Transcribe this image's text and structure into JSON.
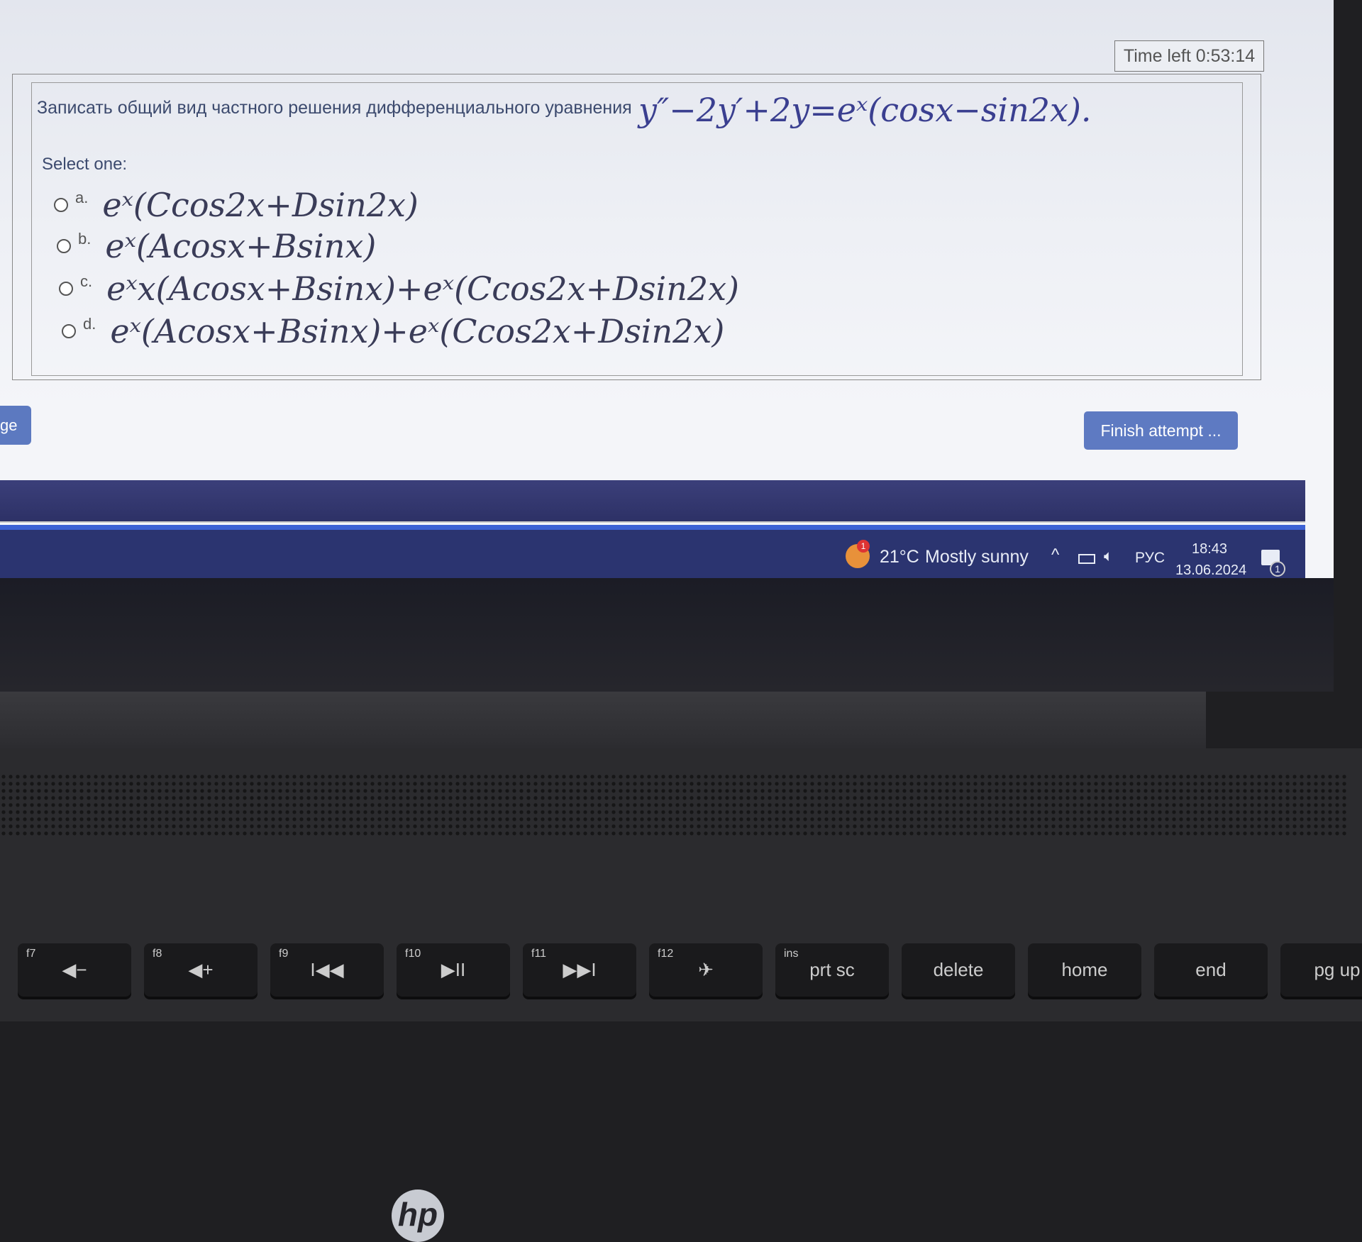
{
  "timer": {
    "label": "Time left 0:53:14"
  },
  "question": {
    "text": "Записать общий вид частного решения дифференциального уравнения",
    "equation": "y″−2y′+2y=eˣ(cosx−sin2x)."
  },
  "select_one": "Select one:",
  "options": [
    {
      "letter": "a.",
      "math": "eˣ(Ccos2x+Dsin2x)"
    },
    {
      "letter": "b.",
      "math": "eˣ(Acosx+Bsinx)"
    },
    {
      "letter": "c.",
      "math": "eˣx(Acosx+Bsinx)+eˣ(Ccos2x+Dsin2x)"
    },
    {
      "letter": "d.",
      "math": "eˣ(Acosx+Bsinx)+eˣ(Ccos2x+Dsin2x)"
    }
  ],
  "nav": {
    "prev_label": "ge",
    "finish_label": "Finish attempt ..."
  },
  "taskbar": {
    "weather_badge": "1",
    "temperature": "21°C",
    "weather": "Mostly sunny",
    "language": "РУС",
    "time": "18:43",
    "date": "13.06.2024",
    "notifications": "1"
  },
  "logo": "hp",
  "keys": [
    {
      "fn": "f7",
      "main": "◀−"
    },
    {
      "fn": "f8",
      "main": "◀+"
    },
    {
      "fn": "f9",
      "main": "I◀◀"
    },
    {
      "fn": "f10",
      "main": "▶II"
    },
    {
      "fn": "f11",
      "main": "▶▶I"
    },
    {
      "fn": "f12",
      "main": "✈"
    },
    {
      "fn": "ins",
      "main": "prt sc"
    },
    {
      "fn": "",
      "main": "delete"
    },
    {
      "fn": "",
      "main": "home"
    },
    {
      "fn": "",
      "main": "end"
    },
    {
      "fn": "",
      "main": "pg up"
    }
  ],
  "colors": {
    "accent": "#5e7ac2",
    "taskbar": "#2b3470",
    "math": "#3a3f90"
  }
}
